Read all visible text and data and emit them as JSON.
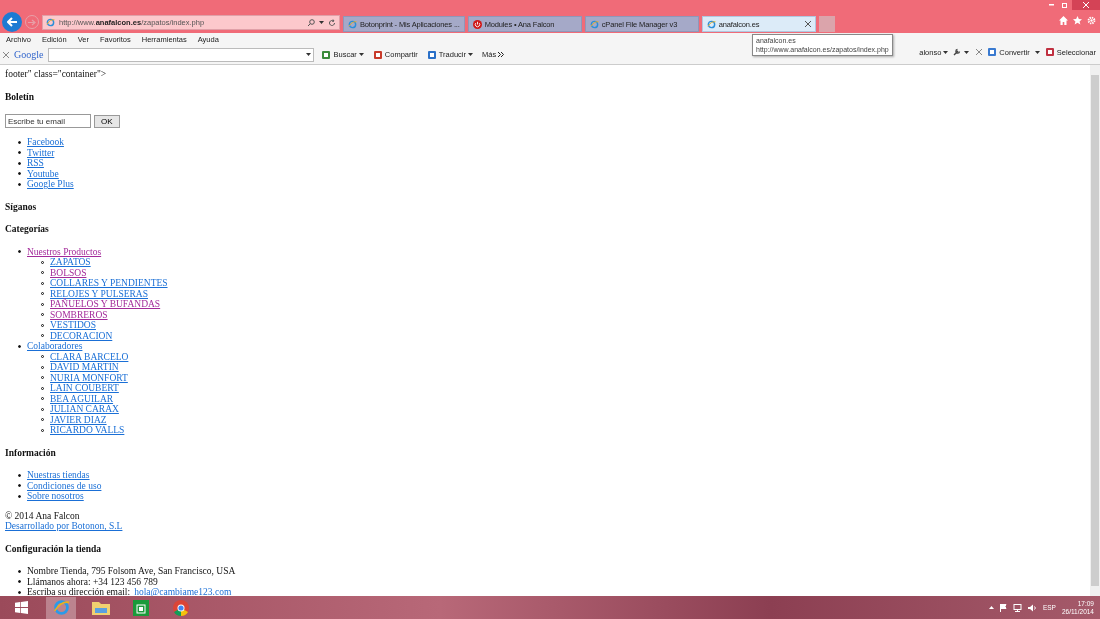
{
  "browser": {
    "address": "http://www.**anafalcon.es**/zapatos/index.php",
    "tabs": [
      {
        "title": "Botonprint - Mis Aplicaciones ...",
        "selected": false
      },
      {
        "title": "Modules • Ana Falcon",
        "selected": false
      },
      {
        "title": "cPanel File Manager v3",
        "selected": false
      },
      {
        "title": "anafalcon.es",
        "selected": true
      }
    ],
    "menu": [
      "Archivo",
      "Edición",
      "Ver",
      "Favoritos",
      "Herramientas",
      "Ayuda"
    ],
    "toolbar": {
      "logo": "Google",
      "buttons": [
        "Buscar",
        "Compartir",
        "Traducir"
      ],
      "more": "Más",
      "user": "alonso",
      "convert": "Convertir",
      "select": "Seleccionar"
    },
    "tooltip": {
      "title": "anafalcon.es",
      "url": "http://www.anafalcon.es/zapatos/index.php"
    }
  },
  "page": {
    "fragment": "footer\" class=\"container\">",
    "newsletter": {
      "heading": "Boletín",
      "value": "Escribe tu email",
      "button": "OK"
    },
    "social": [
      {
        "label": "Facebook",
        "visited": false
      },
      {
        "label": "Twitter",
        "visited": false
      },
      {
        "label": "RSS",
        "visited": false
      },
      {
        "label": "Youtube",
        "visited": false
      },
      {
        "label": "Google Plus",
        "visited": false
      }
    ],
    "follow_heading": "Síganos",
    "categories_heading": "Categorías",
    "categories": [
      {
        "label": "Nuestros Productos",
        "visited": true,
        "children": [
          {
            "label": "ZAPATOS",
            "visited": false
          },
          {
            "label": "BOLSOS",
            "visited": true
          },
          {
            "label": "COLLARES Y PENDIENTES",
            "visited": false
          },
          {
            "label": "RELOJES Y PULSERAS",
            "visited": false
          },
          {
            "label": "PAÑUELOS Y BUFANDAS",
            "visited": true
          },
          {
            "label": "SOMBREROS",
            "visited": true
          },
          {
            "label": "VESTIDOS",
            "visited": false
          },
          {
            "label": "DECORACION",
            "visited": false
          }
        ]
      },
      {
        "label": "Colaboradores",
        "visited": false,
        "children": [
          {
            "label": "CLARA BARCELO",
            "visited": false
          },
          {
            "label": "DAVID MARTIN",
            "visited": false
          },
          {
            "label": "NURIA MONFORT",
            "visited": false
          },
          {
            "label": "LAIN COUBERT",
            "visited": false
          },
          {
            "label": "BEA AGUILAR",
            "visited": false
          },
          {
            "label": "JULIAN CARAX",
            "visited": false
          },
          {
            "label": "JAVIER DIAZ",
            "visited": false
          },
          {
            "label": "RICARDO VALLS",
            "visited": false
          }
        ]
      }
    ],
    "info_heading": "Información",
    "info": [
      {
        "label": "Nuestras tiendas",
        "visited": false
      },
      {
        "label": "Condiciones de uso",
        "visited": false
      },
      {
        "label": "Sobre nosotros",
        "visited": false
      }
    ],
    "copyright": "© 2014 Ana Falcon",
    "developer": {
      "label": "Desarrollado por Botonon, S.L",
      "visited": false
    },
    "config_heading": "Configuración la tienda",
    "config": [
      {
        "text": "Nombre Tienda, 795 Folsom Ave, San Francisco, USA"
      },
      {
        "text": "Llámanos ahora: +34 123 456 789"
      },
      {
        "text": "Escriba su dirección email:",
        "link": "hola@cambiame123.com"
      }
    ]
  },
  "taskbar": {
    "lang": "ESP",
    "time": "17:09",
    "date": "26/11/2014"
  }
}
